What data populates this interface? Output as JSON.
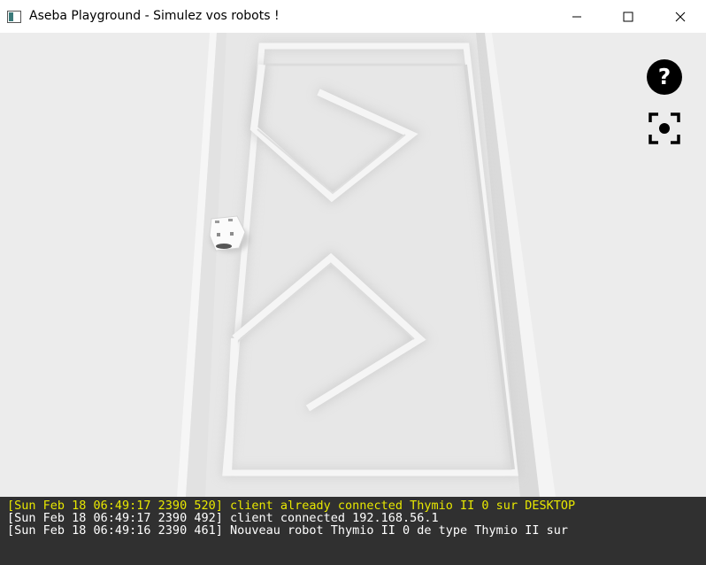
{
  "window": {
    "title": "Aseba Playground - Simulez vos robots !"
  },
  "icons": {
    "app": "app-window-icon",
    "minimize": "minimize-icon",
    "maximize": "maximize-icon",
    "close": "close-icon",
    "help": "help-icon",
    "recenter": "camera-focus-icon"
  },
  "colors": {
    "console_background": "#303030",
    "console_highlight": "#e8e800",
    "console_text": "#ffffff",
    "scene_background": "#ececec"
  },
  "console": {
    "lines": [
      {
        "text": "[Sun Feb 18 06:49:17 2390 520] client already connected Thymio II 0 sur DESKTOP",
        "color": "#e8e800"
      },
      {
        "text": "[Sun Feb 18 06:49:17 2390 492] client connected 192.168.56.1",
        "color": "#ffffff"
      },
      {
        "text": "[Sun Feb 18 06:49:16 2390 461] Nouveau robot Thymio II 0 de type Thymio II sur",
        "color": "#ffffff"
      }
    ]
  }
}
